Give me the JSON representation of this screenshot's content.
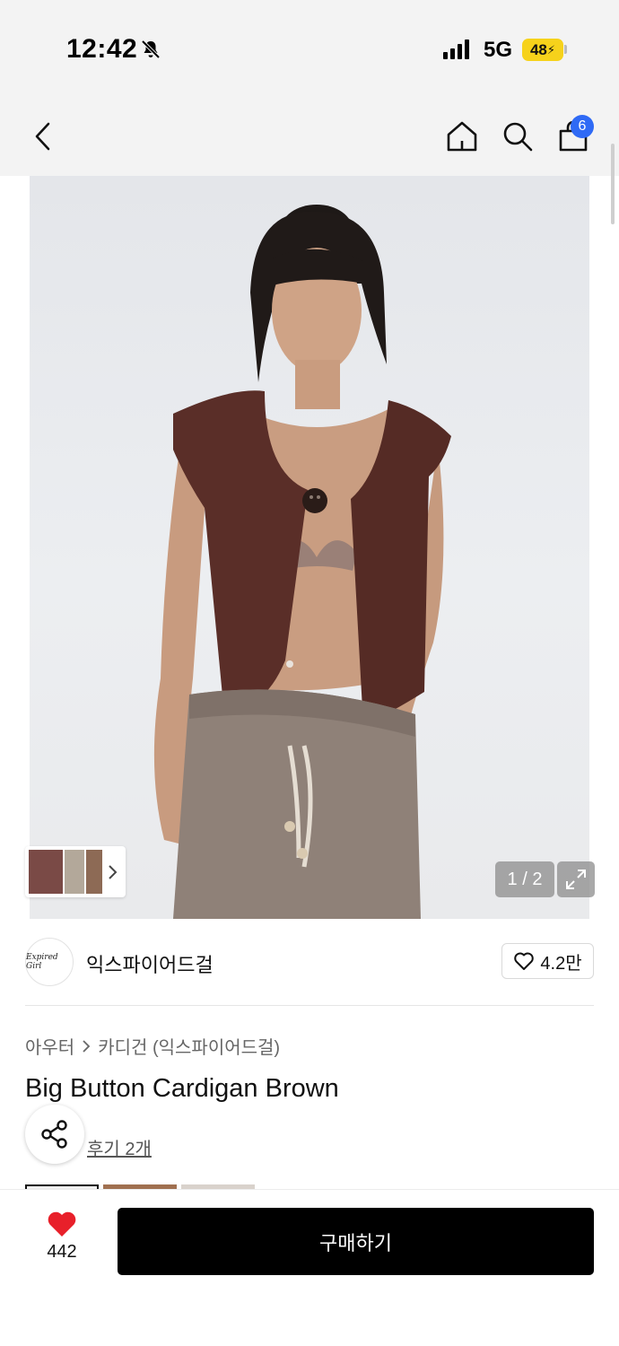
{
  "status_bar": {
    "time": "12:42",
    "network": "5G",
    "battery": "48"
  },
  "header": {
    "cart_count": "6",
    "icons": [
      "back-icon",
      "home-icon",
      "search-icon",
      "shopping-bag-icon"
    ]
  },
  "gallery": {
    "page_indicator": "1 / 2"
  },
  "brand": {
    "logo_text": "Expired Girl",
    "name": "익스파이어드걸",
    "like_count": "4.2만"
  },
  "breadcrumb": {
    "category": "아우터",
    "subcategory": "카디건 (익스파이어드걸)"
  },
  "product": {
    "title": "Big Button Cardigan Brown",
    "reviews": "후기 2개"
  },
  "bottom_bar": {
    "wish_count": "442",
    "buy_label": "구매하기"
  },
  "colors": {
    "accent_blue": "#2f6af5",
    "heart_red": "#e8202a",
    "battery_yellow": "#f6d21b"
  }
}
